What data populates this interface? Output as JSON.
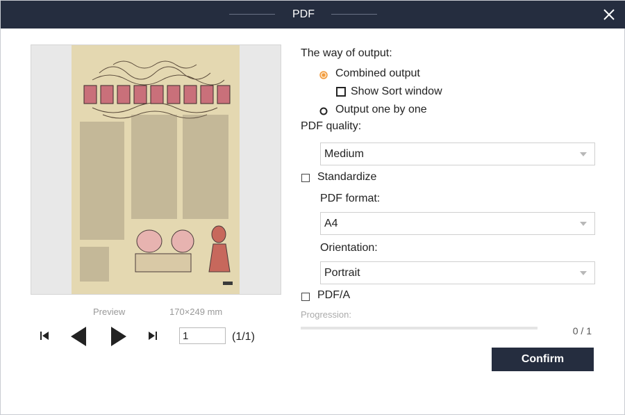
{
  "window": {
    "title": "PDF"
  },
  "preview": {
    "caption": "Preview",
    "size": "170×249 mm",
    "current_page": "1",
    "page_count": "(1/1)"
  },
  "output": {
    "heading": "The way of output:",
    "combined": "Combined output",
    "show_sort": "Show Sort window",
    "one_by_one": "Output one by one",
    "selected": "combined"
  },
  "quality": {
    "label": "PDF quality:",
    "value": "Medium"
  },
  "standardize": {
    "label": "Standardize",
    "checked": false
  },
  "format": {
    "label": "PDF format:",
    "value": "A4"
  },
  "orientation": {
    "label": "Orientation:",
    "value": "Portrait"
  },
  "pdfa": {
    "label": "PDF/A",
    "checked": false
  },
  "progress": {
    "label": "Progression:",
    "count": "0 / 1",
    "fraction": 0
  },
  "buttons": {
    "confirm": "Confirm"
  },
  "colors": {
    "titlebar": "#252d3f",
    "radio_selected": "#f29a3c",
    "page_paper": "#e4d8b1"
  }
}
